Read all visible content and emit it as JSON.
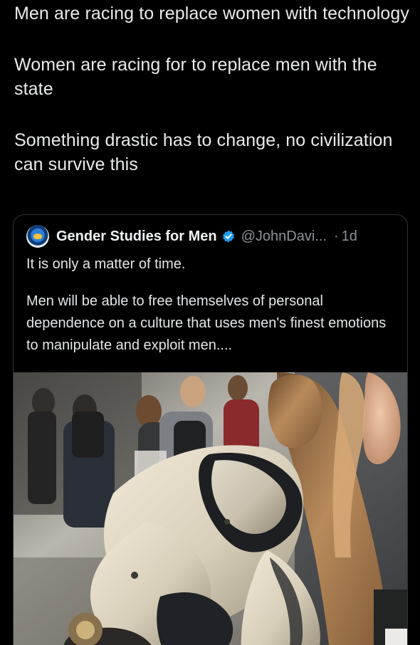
{
  "post": {
    "paragraphs": [
      "Men are racing to replace women with technology",
      "Women are racing for to replace men with the state",
      "Something drastic has to change, no civilization can survive this"
    ]
  },
  "quote": {
    "display_name": "Gender Studies for Men",
    "handle": "@JohnDavi...",
    "separator": "·",
    "time": "1d",
    "paragraphs": [
      "It is only a matter of time.",
      "Men will be able to free themselves of personal dependence on a culture that uses men's finest emotions to manipulate and exploit men...."
    ]
  },
  "colors": {
    "background": "#000000",
    "text": "#e7e9ea",
    "secondary_text": "#8b9299",
    "verified": "#1d9bf0",
    "border": "#2f3336"
  },
  "icons": {
    "verified": "verified-badge-icon",
    "avatar": "profile-avatar"
  }
}
